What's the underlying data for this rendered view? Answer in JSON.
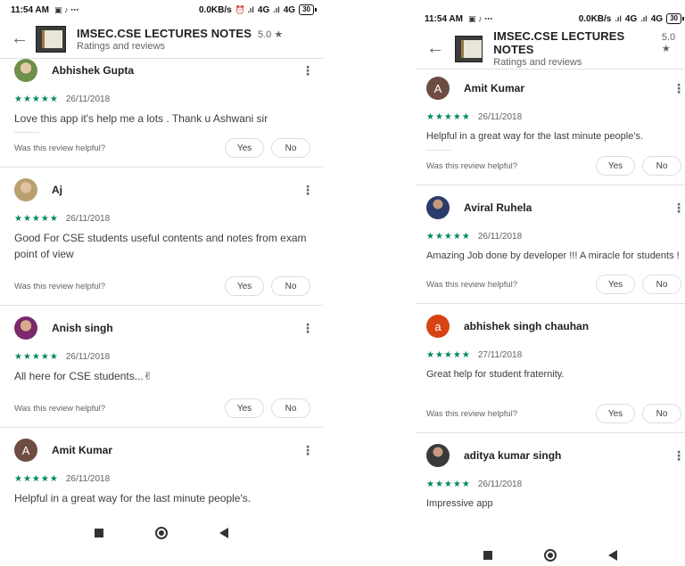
{
  "left": {
    "status": {
      "time": "11:54 AM",
      "speed": "0.0KB/s",
      "network1": "4G",
      "network2": "4G",
      "battery": "30"
    },
    "header": {
      "title": "IMSEC.CSE LECTURES NOTES",
      "rating": "5.0 ★",
      "subtitle": "Ratings and reviews"
    },
    "reviews": [
      {
        "name": "Abhishek Gupta",
        "avatar": "",
        "stars": "★★★★★",
        "date": "26/11/2018",
        "text": "Love this app it's help me a lots . Thank u Ashwani sir",
        "helpful": "Was this review helpful?",
        "yes": "Yes",
        "no": "No"
      },
      {
        "name": "Aj",
        "avatar": "",
        "stars": "★★★★★",
        "date": "26/11/2018",
        "text": "Good For CSE students useful contents and notes from exam point of view",
        "helpful": "Was this review helpful?",
        "yes": "Yes",
        "no": "No"
      },
      {
        "name": "Anish singh",
        "avatar": "",
        "stars": "★★★★★",
        "date": "26/11/2018",
        "text": "All here for CSE students...✌",
        "helpful": "Was this review helpful?",
        "yes": "Yes",
        "no": "No"
      },
      {
        "name": "Amit Kumar",
        "avatar": "A",
        "stars": "★★★★★",
        "date": "26/11/2018",
        "text": "Helpful in a great way for the last minute people's.",
        "helpful": "",
        "yes": "",
        "no": ""
      }
    ]
  },
  "right": {
    "status": {
      "time": "11:54 AM",
      "speed": "0.0KB/s",
      "network1": "4G",
      "network2": "4G",
      "battery": "30"
    },
    "header": {
      "title": "IMSEC.CSE LECTURES NOTES",
      "rating": "5.0 ★",
      "subtitle": "Ratings and reviews"
    },
    "reviews": [
      {
        "name": "Amit Kumar",
        "avatar": "A",
        "stars": "★★★★★",
        "date": "26/11/2018",
        "text": "Helpful in a great way for the last minute people's.",
        "helpful": "Was this review helpful?",
        "yes": "Yes",
        "no": "No"
      },
      {
        "name": "Aviral Ruhela",
        "avatar": "",
        "stars": "★★★★★",
        "date": "26/11/2018",
        "text": "Amazing Job done by developer !!! A miracle for students !",
        "helpful": "Was this review helpful?",
        "yes": "Yes",
        "no": "No"
      },
      {
        "name": "abhishek singh chauhan",
        "avatar": "a",
        "stars": "★★★★★",
        "date": "27/11/2018",
        "text": "Great help for student fraternity.",
        "helpful": "Was this review helpful?",
        "yes": "Yes",
        "no": "No"
      },
      {
        "name": "aditya kumar singh",
        "avatar": "",
        "stars": "★★★★★",
        "date": "26/11/2018",
        "text": "Impressive app",
        "helpful": "",
        "yes": "",
        "no": ""
      }
    ]
  },
  "icons": {
    "back": "arrow-back-icon",
    "more": "more-vert-icon",
    "star": "star-icon"
  },
  "colors": {
    "star_green": "#01875f",
    "divider": "#e0e0e0"
  }
}
